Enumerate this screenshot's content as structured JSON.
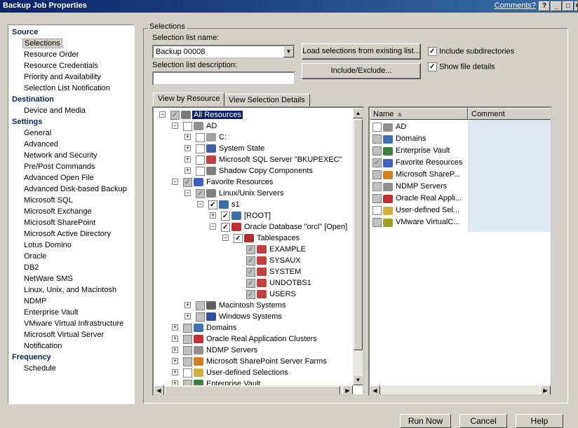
{
  "window": {
    "title": "Backup Job Properties",
    "comments_link": "Comments?",
    "controls": [
      "?",
      "_",
      "□",
      "×"
    ]
  },
  "nav": [
    {
      "type": "header",
      "label": "Source"
    },
    {
      "type": "item",
      "label": "Selections",
      "selected": true
    },
    {
      "type": "item",
      "label": "Resource Order"
    },
    {
      "type": "item",
      "label": "Resource Credentials"
    },
    {
      "type": "item",
      "label": "Priority and Availability"
    },
    {
      "type": "item",
      "label": "Selection List Notification"
    },
    {
      "type": "header",
      "label": "Destination"
    },
    {
      "type": "item",
      "label": "Device and Media"
    },
    {
      "type": "header",
      "label": "Settings"
    },
    {
      "type": "item",
      "label": "General"
    },
    {
      "type": "item",
      "label": "Advanced"
    },
    {
      "type": "item",
      "label": "Network and Security"
    },
    {
      "type": "item",
      "label": "Pre/Post Commands"
    },
    {
      "type": "item",
      "label": "Advanced Open File"
    },
    {
      "type": "item",
      "label": "Advanced Disk-based Backup"
    },
    {
      "type": "item",
      "label": "Microsoft SQL"
    },
    {
      "type": "item",
      "label": "Microsoft Exchange"
    },
    {
      "type": "item",
      "label": "Microsoft SharePoint"
    },
    {
      "type": "item",
      "label": "Microsoft Active Directory"
    },
    {
      "type": "item",
      "label": "Lotus Domino"
    },
    {
      "type": "item",
      "label": "Oracle"
    },
    {
      "type": "item",
      "label": "DB2"
    },
    {
      "type": "item",
      "label": "NetWare SMS"
    },
    {
      "type": "item",
      "label": "Linux, Unix, and Macintosh"
    },
    {
      "type": "item",
      "label": "NDMP"
    },
    {
      "type": "item",
      "label": "Enterprise Vault"
    },
    {
      "type": "item",
      "label": "VMware Virtual Infrastructure"
    },
    {
      "type": "item",
      "label": "Microsoft Virtual Server"
    },
    {
      "type": "item",
      "label": "Notification"
    },
    {
      "type": "header",
      "label": "Frequency"
    },
    {
      "type": "item",
      "label": "Schedule"
    }
  ],
  "selections": {
    "group_label": "Selections",
    "list_name_label": "Selection list name:",
    "list_name_value": "Backup 00008",
    "list_desc_label": "Selection list description:",
    "list_desc_value": "",
    "load_button": "Load selections from existing list...",
    "include_exclude_button": "Include/Exclude...",
    "include_subdirs": "Include subdirectories",
    "show_file_details": "Show file details",
    "tabs": [
      "View by Resource",
      "View Selection Details"
    ]
  },
  "tree": [
    {
      "lvl": 0,
      "exp": "-",
      "chk": "grey-on",
      "icon": "all-resources",
      "color": "#7a7a7a",
      "label": "All Resources",
      "sel": true
    },
    {
      "lvl": 1,
      "exp": "-",
      "chk": "off",
      "icon": "server",
      "color": "#909090",
      "label": "AD"
    },
    {
      "lvl": 2,
      "exp": "+",
      "chk": "off",
      "icon": "drive",
      "color": "#a0a0a0",
      "label": "C:"
    },
    {
      "lvl": 2,
      "exp": "+",
      "chk": "off",
      "icon": "system-state",
      "color": "#4060a0",
      "label": "System State"
    },
    {
      "lvl": 2,
      "exp": "+",
      "chk": "off",
      "icon": "sql-server",
      "color": "#c04040",
      "label": "Microsoft SQL Server \"BKUPEXEC\""
    },
    {
      "lvl": 2,
      "exp": "+",
      "chk": "off",
      "icon": "shadow-copy",
      "color": "#808080",
      "label": "Shadow Copy Components"
    },
    {
      "lvl": 1,
      "exp": "-",
      "chk": "grey-on",
      "icon": "favorites",
      "color": "#4060c0",
      "label": "Favorite Resources"
    },
    {
      "lvl": 2,
      "exp": "-",
      "chk": "grey-on",
      "icon": "linux-servers",
      "color": "#808080",
      "label": "Linux/Unix Servers"
    },
    {
      "lvl": 3,
      "exp": "-",
      "chk": "on",
      "icon": "computer",
      "color": "#3a6ea5",
      "label": "s1"
    },
    {
      "lvl": 4,
      "exp": "+",
      "chk": "on",
      "icon": "computer",
      "color": "#3a6ea5",
      "label": "[ROOT]"
    },
    {
      "lvl": 4,
      "exp": "-",
      "chk": "on",
      "icon": "oracle-db",
      "color": "#c03030",
      "label": "Oracle Database \"orcl\" [Open]"
    },
    {
      "lvl": 5,
      "exp": "-",
      "chk": "on",
      "icon": "tablespaces",
      "color": "#b03030",
      "label": "Tablespaces"
    },
    {
      "lvl": 6,
      "exp": "",
      "chk": "grey-on",
      "icon": "tablespace",
      "color": "#c04040",
      "label": "EXAMPLE"
    },
    {
      "lvl": 6,
      "exp": "",
      "chk": "grey-on",
      "icon": "tablespace",
      "color": "#c04040",
      "label": "SYSAUX"
    },
    {
      "lvl": 6,
      "exp": "",
      "chk": "grey-on",
      "icon": "tablespace",
      "color": "#c04040",
      "label": "SYSTEM"
    },
    {
      "lvl": 6,
      "exp": "",
      "chk": "grey-on",
      "icon": "tablespace",
      "color": "#c04040",
      "label": "UNDOTBS1"
    },
    {
      "lvl": 6,
      "exp": "",
      "chk": "grey-on",
      "icon": "tablespace",
      "color": "#c04040",
      "label": "USERS"
    },
    {
      "lvl": 2,
      "exp": "+",
      "chk": "grey",
      "icon": "mac-systems",
      "color": "#606060",
      "label": "Macintosh Systems"
    },
    {
      "lvl": 2,
      "exp": "+",
      "chk": "grey",
      "icon": "windows-systems",
      "color": "#3050a0",
      "label": "Windows Systems"
    },
    {
      "lvl": 1,
      "exp": "+",
      "chk": "grey",
      "icon": "domains",
      "color": "#4070b0",
      "label": "Domains"
    },
    {
      "lvl": 1,
      "exp": "+",
      "chk": "grey",
      "icon": "oracle-rac",
      "color": "#c03030",
      "label": "Oracle Real Application Clusters"
    },
    {
      "lvl": 1,
      "exp": "+",
      "chk": "grey",
      "icon": "ndmp",
      "color": "#909090",
      "label": "NDMP Servers"
    },
    {
      "lvl": 1,
      "exp": "+",
      "chk": "grey",
      "icon": "sharepoint",
      "color": "#d08020",
      "label": "Microsoft SharePoint Server Farms"
    },
    {
      "lvl": 1,
      "exp": "+",
      "chk": "off",
      "icon": "user-defined",
      "color": "#d0b040",
      "label": "User-defined Selections"
    },
    {
      "lvl": 1,
      "exp": "+",
      "chk": "grey",
      "icon": "enterprise-vault",
      "color": "#408040",
      "label": "Enterprise Vault"
    }
  ],
  "list": {
    "col_name": "Name",
    "col_comment": "Comment",
    "rows": [
      {
        "chk": "off",
        "icon": "server",
        "color": "#909090",
        "label": "AD"
      },
      {
        "chk": "grey",
        "icon": "domains",
        "color": "#4070b0",
        "label": "Domains"
      },
      {
        "chk": "grey",
        "icon": "enterprise-vault",
        "color": "#408040",
        "label": "Enterprise Vault"
      },
      {
        "chk": "grey-on",
        "icon": "favorites",
        "color": "#4060c0",
        "label": "Favorite Resources"
      },
      {
        "chk": "grey",
        "icon": "sharepoint",
        "color": "#d08020",
        "label": "Microsoft ShareP..."
      },
      {
        "chk": "grey",
        "icon": "ndmp",
        "color": "#909090",
        "label": "NDMP Servers"
      },
      {
        "chk": "grey",
        "icon": "oracle-rac",
        "color": "#c03030",
        "label": "Oracle Real Appli..."
      },
      {
        "chk": "off",
        "icon": "user-defined",
        "color": "#d0b040",
        "label": "User-defined Sel..."
      },
      {
        "chk": "grey",
        "icon": "vmware",
        "color": "#a0a020",
        "label": "VMware VirtualC..."
      }
    ]
  },
  "footer": {
    "run_now": "Run Now",
    "cancel": "Cancel",
    "help": "Help"
  }
}
